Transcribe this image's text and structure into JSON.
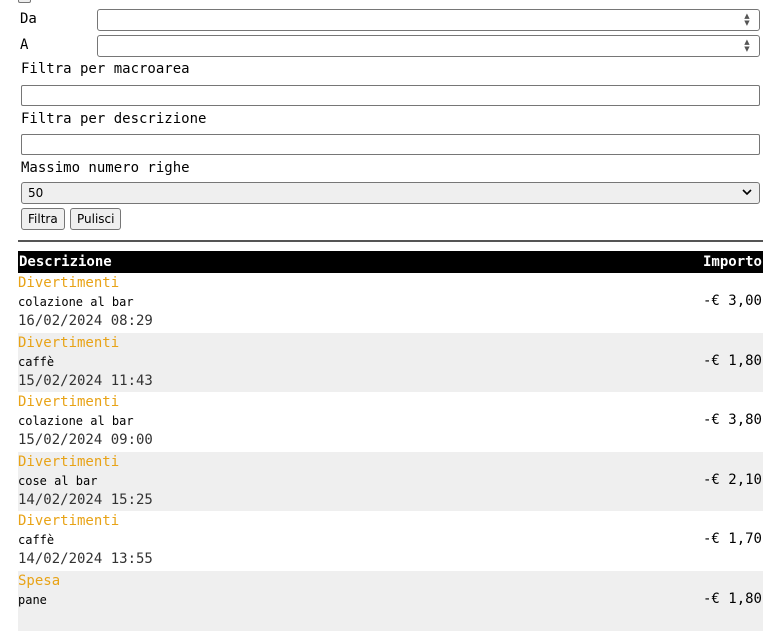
{
  "form": {
    "top_checkbox_label": "",
    "from_label": "Da",
    "from_value": "",
    "to_label": "A",
    "to_value": "",
    "macro_label": "Filtra per macroarea",
    "macro_value": "",
    "desc_label": "Filtra per descrizione",
    "desc_value": "",
    "maxrows_label": "Massimo numero righe",
    "maxrows_selected": "50",
    "filter_button": "Filtra",
    "clear_button": "Pulisci"
  },
  "table": {
    "header_description": "Descrizione",
    "header_amount": "Importo",
    "rows": [
      {
        "category": "Divertimenti",
        "description": "colazione al bar",
        "date": "16/02/2024 08:29",
        "amount": "-€ 3,00"
      },
      {
        "category": "Divertimenti",
        "description": "caffè",
        "date": "15/02/2024 11:43",
        "amount": "-€ 1,80"
      },
      {
        "category": "Divertimenti",
        "description": "colazione al bar",
        "date": "15/02/2024 09:00",
        "amount": "-€ 3,80"
      },
      {
        "category": "Divertimenti",
        "description": "cose al bar",
        "date": "14/02/2024 15:25",
        "amount": "-€ 2,10"
      },
      {
        "category": "Divertimenti",
        "description": "caffè",
        "date": "14/02/2024 13:55",
        "amount": "-€ 1,70"
      },
      {
        "category": "Spesa",
        "description": "pane",
        "date": "",
        "amount": "-€ 1,80"
      }
    ]
  },
  "colors": {
    "category_text": "#e8a317",
    "header_bg": "#000000",
    "alt_row_bg": "#efefef"
  },
  "icons": {
    "spinner": "spinner-arrows-icon",
    "select_chevron": "chevron-down-icon"
  }
}
